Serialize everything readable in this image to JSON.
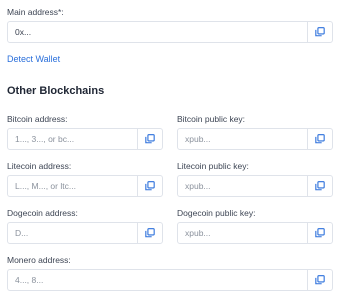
{
  "main": {
    "label": "Main address*:",
    "value": "0x...",
    "detect_link": "Detect Wallet"
  },
  "other": {
    "heading": "Other Blockchains",
    "bitcoin_address": {
      "label": "Bitcoin address:",
      "placeholder": "1..., 3..., or bc..."
    },
    "bitcoin_pubkey": {
      "label": "Bitcoin public key:",
      "placeholder": "xpub..."
    },
    "litecoin_address": {
      "label": "Litecoin address:",
      "placeholder": "L..., M..., or ltc..."
    },
    "litecoin_pubkey": {
      "label": "Litecoin public key:",
      "placeholder": "xpub..."
    },
    "dogecoin_address": {
      "label": "Dogecoin address:",
      "placeholder": "D..."
    },
    "dogecoin_pubkey": {
      "label": "Dogecoin public key:",
      "placeholder": "xpub..."
    },
    "monero_address": {
      "label": "Monero address:",
      "placeholder": "4..., 8..."
    }
  },
  "icons": {
    "copy": "copy-icon"
  },
  "colors": {
    "link": "#2a6fdb",
    "copy_icon": "#2a6fdb",
    "border": "#dfe3ea"
  }
}
